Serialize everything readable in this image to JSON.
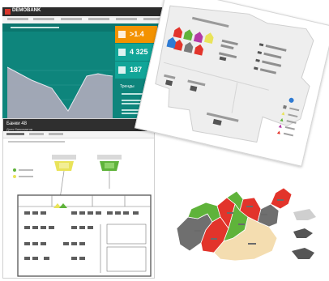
{
  "dashboard": {
    "brand": "DEMOBANK",
    "kpis": [
      {
        "value": ">1.4",
        "color": "#f39200"
      },
      {
        "value": "4 325",
        "color": "#11a598"
      },
      {
        "value": "187",
        "color": "#11a598"
      }
    ],
    "list_heading": "Тренды"
  },
  "window": {
    "title": "Банки 48",
    "subtitle": "Доля банкоматов"
  },
  "colors": {
    "teal": "#0e857c",
    "orange": "#f39200",
    "yellow": "#e9e35a",
    "green": "#5fb33a",
    "red": "#e2342b",
    "beige": "#f4ddb0",
    "grey": "#8c8c8c"
  }
}
